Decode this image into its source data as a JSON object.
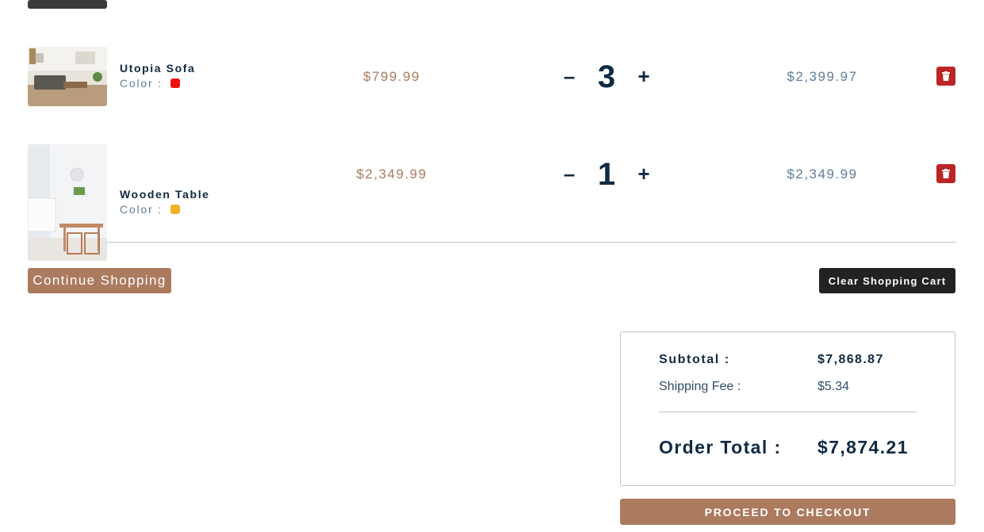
{
  "cart": {
    "items": [
      {
        "name": "Utopia Sofa",
        "color_label": "Color :",
        "color": "#ee1111",
        "price": "$799.99",
        "quantity": "3",
        "subtotal": "$2,399.97",
        "image_icon": "living-room-photo"
      },
      {
        "name": "Wooden Table",
        "color_label": "Color :",
        "color": "#f0b429",
        "price": "$2,349.99",
        "quantity": "1",
        "subtotal": "$2,349.99",
        "image_icon": "dining-room-photo"
      }
    ],
    "decrease_symbol": "–",
    "increase_symbol": "+",
    "delete_icon": "trash-icon"
  },
  "actions": {
    "continue_label": "Continue Shopping",
    "clear_label": "Clear Shopping Cart",
    "checkout_label": "PROCEED TO CHECKOUT"
  },
  "totals": {
    "subtotal_label": "Subtotal :",
    "subtotal_value": "$7,868.87",
    "shipping_label": "Shipping Fee :",
    "shipping_value": "$5.34",
    "order_total_label": "Order Total :",
    "order_total_value": "$7,874.21"
  },
  "colors": {
    "primary": "#ab7a5f",
    "dark_text": "#102a42",
    "muted_text": "#617d98",
    "delete_red": "#bb2525",
    "dark_button": "#222222"
  }
}
